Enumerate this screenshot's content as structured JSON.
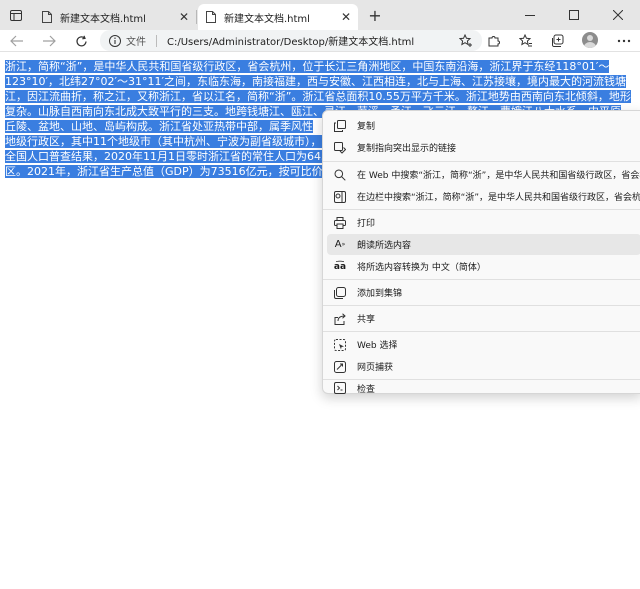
{
  "tabs": [
    {
      "title": "新建文本文档.html",
      "active": false
    },
    {
      "title": "新建文本文档.html",
      "active": true
    }
  ],
  "address": {
    "label": "文件",
    "url": "C:/Users/Administrator/Desktop/新建文本文档.html"
  },
  "content": {
    "lines": [
      "浙江，简称“浙”，是中华人民共和国省级行政区，省会杭州，位于长江三角洲地区，中国东南沿海，浙江界于东经118°01′～",
      "123°10′，北纬27°02′～31°11′之间，东临东海，南接福建，西与安徽、江西相连，北与上海、江苏接壤，境内最大的河流钱塘",
      "江，因江流曲折，称之江，又称浙江，省以江名，简称“浙”。浙江省总面积10.55万平方千米。浙江地势由西南向东北倾斜，地形",
      "复杂。山脉自西南向东北成大致平行的三支。地跨钱塘江、瓯江、灵江、苕溪、甬江、飞云江、鳌江、曹娥江八大水系，中平原",
      "丘陵、盆地、山地、岛屿构成。浙江省处亚热带中部，属季风性",
      "地级行政区，其中11个地级市（其中杭州、宁波为副省级城市），",
      "全国人口普查结果，2020年11月1日零时浙江省的常住人口为645",
      "区。2021年，浙江省生产总值（GDP）为73516亿元，按可比价"
    ]
  },
  "context_menu": {
    "items": [
      {
        "icon": "copy-icon",
        "label": "复制"
      },
      {
        "icon": "copy-link-icon",
        "label": "复制指向突出显示的链接"
      },
      {
        "icon": "search-icon",
        "label": "在 Web 中搜索“浙江，简称“浙”，是中华人民共和国省级行政区，省会杭州，位"
      },
      {
        "icon": "sidebar-search-icon",
        "label": "在边栏中搜索“浙江，简称“浙”，是中华人民共和国省级行政区，省会杭州，位"
      },
      {
        "icon": "print-icon",
        "label": "打印"
      },
      {
        "icon": "read-aloud-icon",
        "label": "朗读所选内容"
      },
      {
        "icon": "translate-icon",
        "label": "将所选内容转换为 中文（简体）"
      },
      {
        "icon": "collections-icon",
        "label": "添加到集锦"
      },
      {
        "icon": "share-icon",
        "label": "共享"
      },
      {
        "icon": "web-select-icon",
        "label": "Web 选择"
      },
      {
        "icon": "web-capture-icon",
        "label": "网页捕获"
      },
      {
        "icon": "inspect-icon",
        "label": "检查"
      }
    ]
  },
  "colors": {
    "selection": "#3a7ee0",
    "tabstrip": "#e6e6e6"
  }
}
